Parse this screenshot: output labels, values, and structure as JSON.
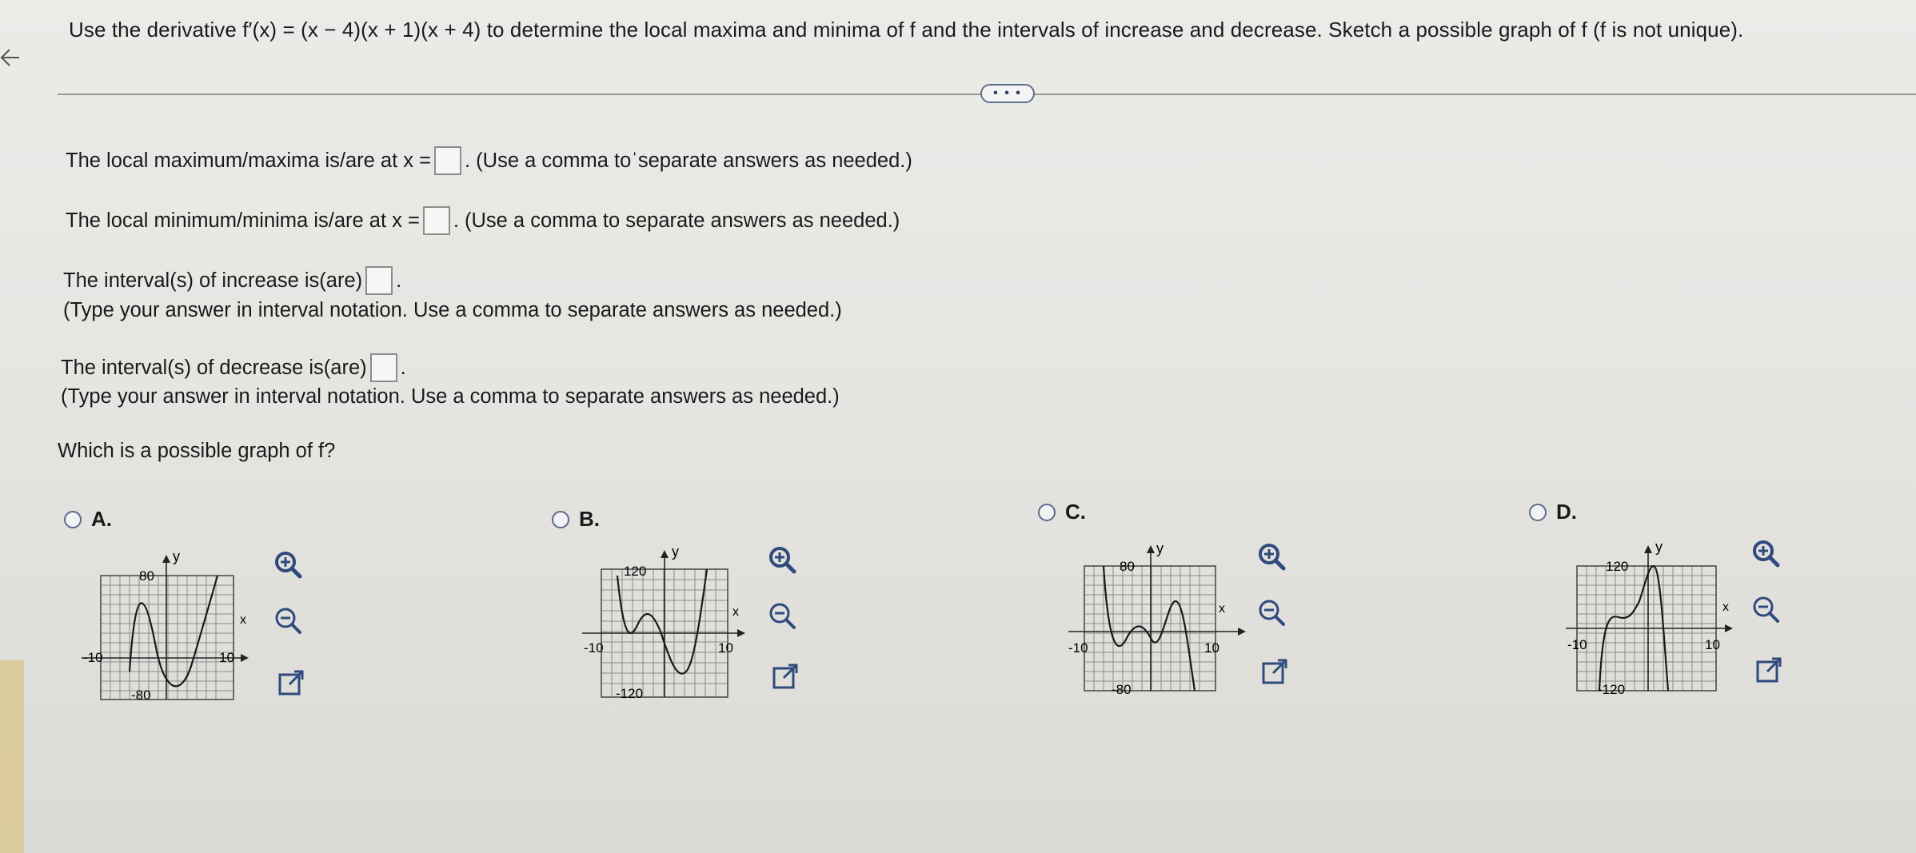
{
  "question": {
    "text": "Use the derivative f′(x) = (x − 4)(x + 1)(x + 4) to determine the local maxima and minima of f and the intervals of increase and decrease. Sketch a possible graph of f (f is not unique)."
  },
  "more_button": "• • •",
  "answers": {
    "max_prefix": "The local maximum/maxima is/are at x =",
    "max_suffix": ". (Use a comma toˈseparate answers as needed.)",
    "min_prefix": "The local minimum/minima is/are at x =",
    "min_suffix": ". (Use a comma to separate answers as needed.)",
    "increase_prefix": "The interval(s) of increase is(are)",
    "increase_suffix": ".",
    "increase_note": "(Type your answer in interval notation. Use a comma to separate answers as needed.)",
    "decrease_prefix": "The interval(s) of decrease is(are)",
    "decrease_suffix": ".",
    "decrease_note": "(Type your answer in interval notation. Use a comma to separate answers as needed.)",
    "graph_prompt": "Which is a possible graph of f?"
  },
  "options": [
    {
      "letter": "A.",
      "ytop": "80",
      "ybot": "-80",
      "xl": "-10",
      "xr": "10",
      "xaxis": "x",
      "yaxis": "y"
    },
    {
      "letter": "B.",
      "ytop": "120",
      "ybot": "-120",
      "xl": "-10",
      "xr": "10",
      "xaxis": "x",
      "yaxis": "y"
    },
    {
      "letter": "C.",
      "ytop": "80",
      "ybot": "-80",
      "xl": "-10",
      "xr": "10",
      "xaxis": "x",
      "yaxis": "y"
    },
    {
      "letter": "D.",
      "ytop": "120",
      "ybot": "-120",
      "xl": "-10",
      "xr": "10",
      "xaxis": "x",
      "yaxis": "y"
    }
  ],
  "icons": {
    "back": "back-arrow-icon",
    "zoom_in": "zoom-in-icon",
    "zoom_out": "zoom-out-icon",
    "popout": "external-link-icon"
  },
  "colors": {
    "accent": "#2f4a7c",
    "text": "#1a1a1a"
  }
}
